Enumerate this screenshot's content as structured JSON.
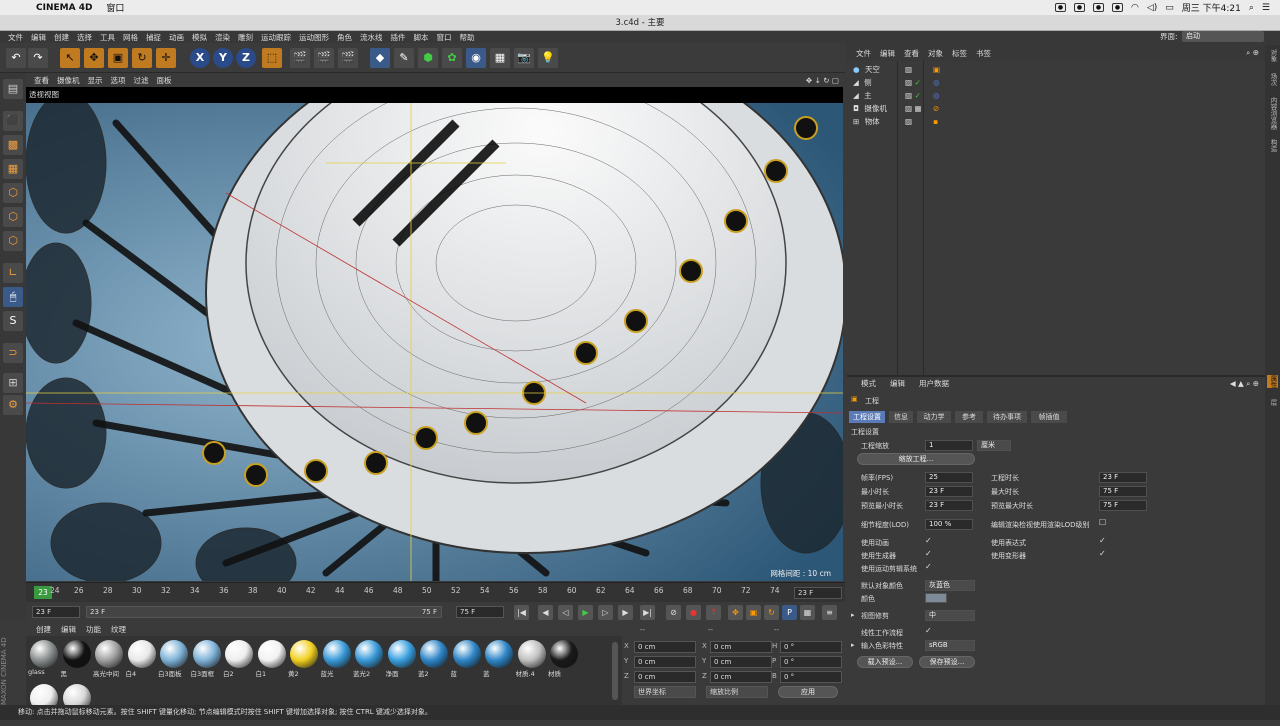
{
  "macbar": {
    "app": "CINEMA 4D",
    "menu": "窗口",
    "clock": "周三 下午4:21"
  },
  "window": {
    "title": "3.c4d - 主要"
  },
  "mainmenu": [
    "文件",
    "编辑",
    "创建",
    "选择",
    "工具",
    "网格",
    "捕捉",
    "动画",
    "模拟",
    "渲染",
    "雕刻",
    "运动跟踪",
    "运动图形",
    "角色",
    "流水线",
    "插件",
    "脚本",
    "窗口",
    "帮助"
  ],
  "layout": {
    "label": "界面:",
    "value": "启动"
  },
  "viewport": {
    "menu": [
      "查看",
      "摄像机",
      "显示",
      "选项",
      "过滤",
      "面板"
    ],
    "title": "透视视图",
    "grid_label": "网格间距 : 10 cm"
  },
  "timeline": {
    "current": "23",
    "ticks": [
      "24",
      "26",
      "28",
      "30",
      "32",
      "34",
      "36",
      "38",
      "40",
      "42",
      "44",
      "46",
      "48",
      "50",
      "52",
      "54",
      "56",
      "58",
      "60",
      "62",
      "64",
      "66",
      "68",
      "70",
      "72",
      "74"
    ],
    "end_field": "23 F"
  },
  "transport": {
    "start": "23 F",
    "range_start": "23 F",
    "range_end": "75 F",
    "end": "75 F"
  },
  "materials": {
    "menu": [
      "创建",
      "编辑",
      "功能",
      "纹理"
    ],
    "items": [
      {
        "label": "glass",
        "color": "#8a8f8f"
      },
      {
        "label": "黑",
        "color": "#111111"
      },
      {
        "label": "高光中间",
        "color": "#a0a0a0"
      },
      {
        "label": "白4",
        "color": "#e8e8e8"
      },
      {
        "label": "白3面板",
        "color": "#7fb3d8"
      },
      {
        "label": "白3面框",
        "color": "#7fb3d8"
      },
      {
        "label": "白2",
        "color": "#eeeeee"
      },
      {
        "label": "白1",
        "color": "#f2f2f2"
      },
      {
        "label": "黄2",
        "color": "#f2d020"
      },
      {
        "label": "蓝光",
        "color": "#3a9ad8"
      },
      {
        "label": "蓝光2",
        "color": "#3a9ad8"
      },
      {
        "label": "净面",
        "color": "#3aa0e0"
      },
      {
        "label": "蓝2",
        "color": "#2f86c8"
      },
      {
        "label": "蓝",
        "color": "#2f86c8"
      },
      {
        "label": "蓝",
        "color": "#2f86c8"
      },
      {
        "label": "材质.4",
        "color": "#c0c0c0"
      },
      {
        "label": "材质",
        "color": "#1a1a1a"
      },
      {
        "label": "",
        "color": "#eeeeee"
      },
      {
        "label": "",
        "color": "#d8d8d8"
      }
    ]
  },
  "coords": {
    "header": [
      "--",
      "--",
      "--"
    ],
    "rows": [
      {
        "a": "X",
        "av": "0 cm",
        "b": "X",
        "bv": "0 cm",
        "c": "H",
        "cv": "0 °"
      },
      {
        "a": "Y",
        "av": "0 cm",
        "b": "Y",
        "bv": "0 cm",
        "c": "P",
        "cv": "0 °"
      },
      {
        "a": "Z",
        "av": "0 cm",
        "b": "Z",
        "bv": "0 cm",
        "c": "B",
        "cv": "0 °"
      }
    ],
    "world": "世界坐标",
    "scale": "缩放比例",
    "apply": "应用"
  },
  "status": "移动: 点击并拖动鼠标移动元素。按住 SHIFT 键量化移动; 节点编辑模式时按住 SHIFT 键增加选择对象; 按住 CTRL 键减少选择对象。",
  "objects": {
    "menu": [
      "文件",
      "编辑",
      "查看",
      "对象",
      "标签",
      "书签"
    ],
    "rows": [
      "天空",
      "侧",
      "主",
      "摄像机",
      "物体"
    ]
  },
  "attributes": {
    "menu": [
      "模式",
      "编辑",
      "用户数据"
    ],
    "section": "工程",
    "tabs": [
      "工程设置",
      "信息",
      "动力学",
      "参考",
      "待办事项",
      "帧插值"
    ],
    "heading": "工程设置",
    "scale_label": "工程缩放",
    "scale_value": "1",
    "scale_unit": "厘米",
    "scale_btn": "缩放工程...",
    "fps_label": "帧率(FPS)",
    "fps": "25",
    "len_label": "工程时长",
    "len": "23 F",
    "min_label": "最小时长",
    "min": "23 F",
    "max_label": "最大时长",
    "max": "75 F",
    "pmin_label": "预览最小时长",
    "pmin": "23 F",
    "pmax_label": "预览最大时长",
    "pmax": "75 F",
    "lod_label": "细节程度(LOD)",
    "lod": "100 %",
    "lod_check": "编辑渲染检视使用渲染LOD级别",
    "use_anim": "使用动画",
    "use_expr": "使用表达式",
    "use_gen": "使用生成器",
    "use_deform": "使用变形器",
    "use_motion": "使用运动剪辑系统",
    "obj_color_label": "默认对象颜色",
    "obj_color": "灰蓝色",
    "color_label": "颜色",
    "clip_label": "视图修剪",
    "clip": "中",
    "linear_label": "线性工作流程",
    "profile_label": "输入色彩特性",
    "profile": "sRGB",
    "load_btn": "载入预设...",
    "save_btn": "保存预设..."
  },
  "rightstrip": [
    "对象",
    "场次",
    "内容浏览器",
    "构造",
    "属性",
    "层"
  ]
}
